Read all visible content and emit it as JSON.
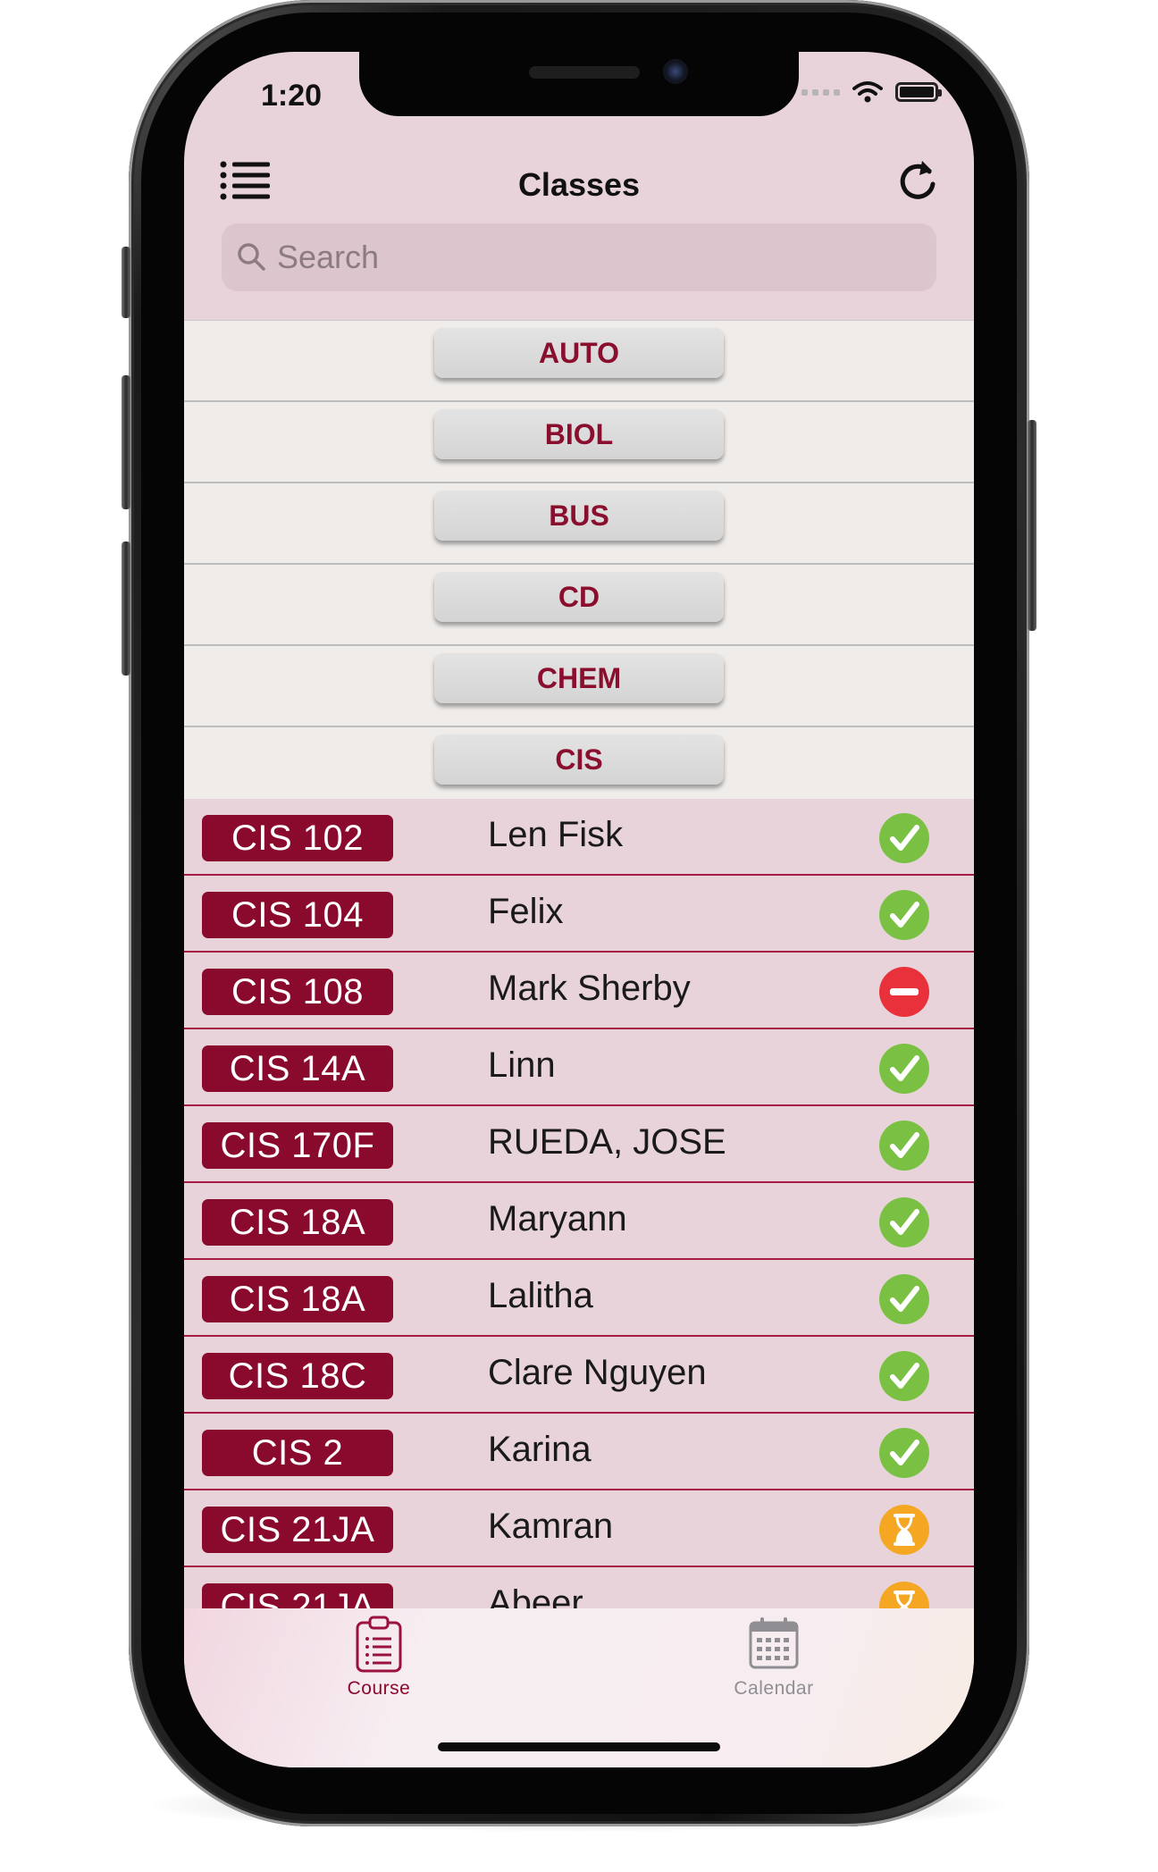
{
  "status_bar": {
    "time": "1:20"
  },
  "nav": {
    "title": "Classes"
  },
  "search": {
    "placeholder": "Search"
  },
  "departments": [
    "AUTO",
    "BIOL",
    "BUS",
    "CD",
    "CHEM",
    "CIS"
  ],
  "classes": [
    {
      "code": "CIS 102",
      "instructor": "Len Fisk",
      "status": "open"
    },
    {
      "code": "CIS 104",
      "instructor": "Felix",
      "status": "open"
    },
    {
      "code": "CIS 108",
      "instructor": "Mark Sherby",
      "status": "closed"
    },
    {
      "code": "CIS 14A",
      "instructor": "Linn",
      "status": "open"
    },
    {
      "code": "CIS 170F",
      "instructor": "RUEDA, JOSE",
      "status": "open"
    },
    {
      "code": "CIS 18A",
      "instructor": "Maryann",
      "status": "open"
    },
    {
      "code": "CIS 18A",
      "instructor": "Lalitha",
      "status": "open"
    },
    {
      "code": "CIS 18C",
      "instructor": "Clare Nguyen",
      "status": "open"
    },
    {
      "code": "CIS 2",
      "instructor": "Karina",
      "status": "open"
    },
    {
      "code": "CIS 21JA",
      "instructor": "Kamran",
      "status": "waitlist"
    },
    {
      "code": "CIS 21JA",
      "instructor": "Abeer",
      "status": "waitlist"
    }
  ],
  "status_icons": {
    "open": "check-circle-icon",
    "closed": "minus-circle-icon",
    "waitlist": "hourglass-icon"
  },
  "colors": {
    "accent": "#8a0a2e",
    "open": "#7ac143",
    "closed": "#e8313a",
    "waitlist": "#f5a623",
    "list_bg": "#e8d3da"
  },
  "tabs": [
    {
      "label": "Course",
      "icon": "clipboard-icon",
      "active": true
    },
    {
      "label": "Calendar",
      "icon": "calendar-icon",
      "active": false
    }
  ]
}
